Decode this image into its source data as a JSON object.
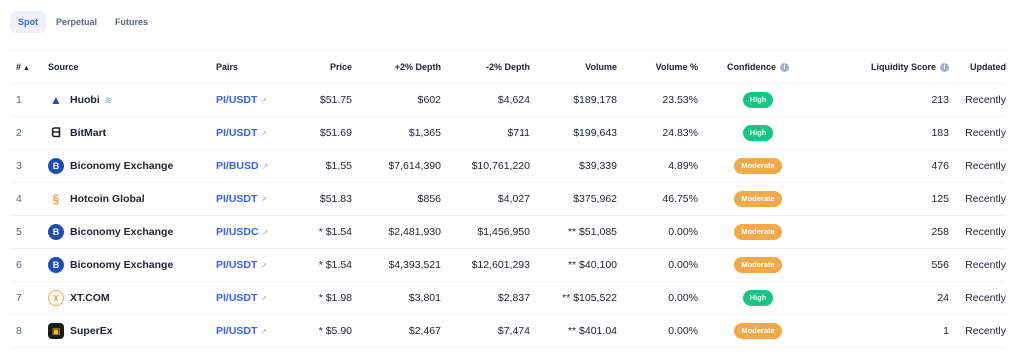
{
  "tabs": [
    {
      "label": "Spot",
      "active": true
    },
    {
      "label": "Perpetual",
      "active": false
    },
    {
      "label": "Futures",
      "active": false
    }
  ],
  "headers": {
    "index": "#",
    "source": "Source",
    "pairs": "Pairs",
    "price": "Price",
    "plus_depth": "+2% Depth",
    "minus_depth": "-2% Depth",
    "volume": "Volume",
    "volume_pct": "Volume %",
    "confidence": "Confidence",
    "liquidity": "Liquidity Score",
    "updated": "Updated"
  },
  "rows": [
    {
      "index": "1",
      "source": "Huobi",
      "pair": "PI/USDT",
      "price": "$51.75",
      "plus_depth": "$602",
      "minus_depth": "$4,624",
      "volume": "$189,178",
      "volume_pct": "23.53%",
      "confidence": "High",
      "liquidity": "213",
      "updated": "Recently"
    },
    {
      "index": "2",
      "source": "BitMart",
      "pair": "PI/USDT",
      "price": "$51.69",
      "plus_depth": "$1,365",
      "minus_depth": "$711",
      "volume": "$199,643",
      "volume_pct": "24.83%",
      "confidence": "High",
      "liquidity": "183",
      "updated": "Recently"
    },
    {
      "index": "3",
      "source": "Biconomy Exchange",
      "pair": "PI/BUSD",
      "price": "$1.55",
      "plus_depth": "$7,614,390",
      "minus_depth": "$10,761,220",
      "volume": "$39,339",
      "volume_pct": "4.89%",
      "confidence": "Moderate",
      "liquidity": "476",
      "updated": "Recently"
    },
    {
      "index": "4",
      "source": "Hotcoin Global",
      "pair": "PI/USDT",
      "price": "$51.83",
      "plus_depth": "$856",
      "minus_depth": "$4,027",
      "volume": "$375,962",
      "volume_pct": "46.75%",
      "confidence": "Moderate",
      "liquidity": "125",
      "updated": "Recently"
    },
    {
      "index": "5",
      "source": "Biconomy Exchange",
      "pair": "PI/USDC",
      "price": "* $1.54",
      "plus_depth": "$2,481,930",
      "minus_depth": "$1,456,950",
      "volume": "** $51,085",
      "volume_pct": "0.00%",
      "confidence": "Moderate",
      "liquidity": "258",
      "updated": "Recently"
    },
    {
      "index": "6",
      "source": "Biconomy Exchange",
      "pair": "PI/USDT",
      "price": "* $1.54",
      "plus_depth": "$4,393,521",
      "minus_depth": "$12,601,293",
      "volume": "** $40,100",
      "volume_pct": "0.00%",
      "confidence": "Moderate",
      "liquidity": "556",
      "updated": "Recently"
    },
    {
      "index": "7",
      "source": "XT.COM",
      "pair": "PI/USDT",
      "price": "* $1.98",
      "plus_depth": "$3,801",
      "minus_depth": "$2,837",
      "volume": "** $105,522",
      "volume_pct": "0.00%",
      "confidence": "High",
      "liquidity": "24",
      "updated": "Recently"
    },
    {
      "index": "8",
      "source": "SuperEx",
      "pair": "PI/USDT",
      "price": "* $5.90",
      "plus_depth": "$2,467",
      "minus_depth": "$7,474",
      "volume": "** $401.04",
      "volume_pct": "0.00%",
      "confidence": "Moderate",
      "liquidity": "1",
      "updated": "Recently"
    }
  ],
  "colors": {
    "accent": "#3861fb",
    "high": "#16c784",
    "moderate": "#f3a84a"
  },
  "icons": {
    "sort": "sort-up-triangle-icon",
    "external": "external-link-icon",
    "info": "info-circle-icon",
    "verified": "verified-layers-icon"
  }
}
